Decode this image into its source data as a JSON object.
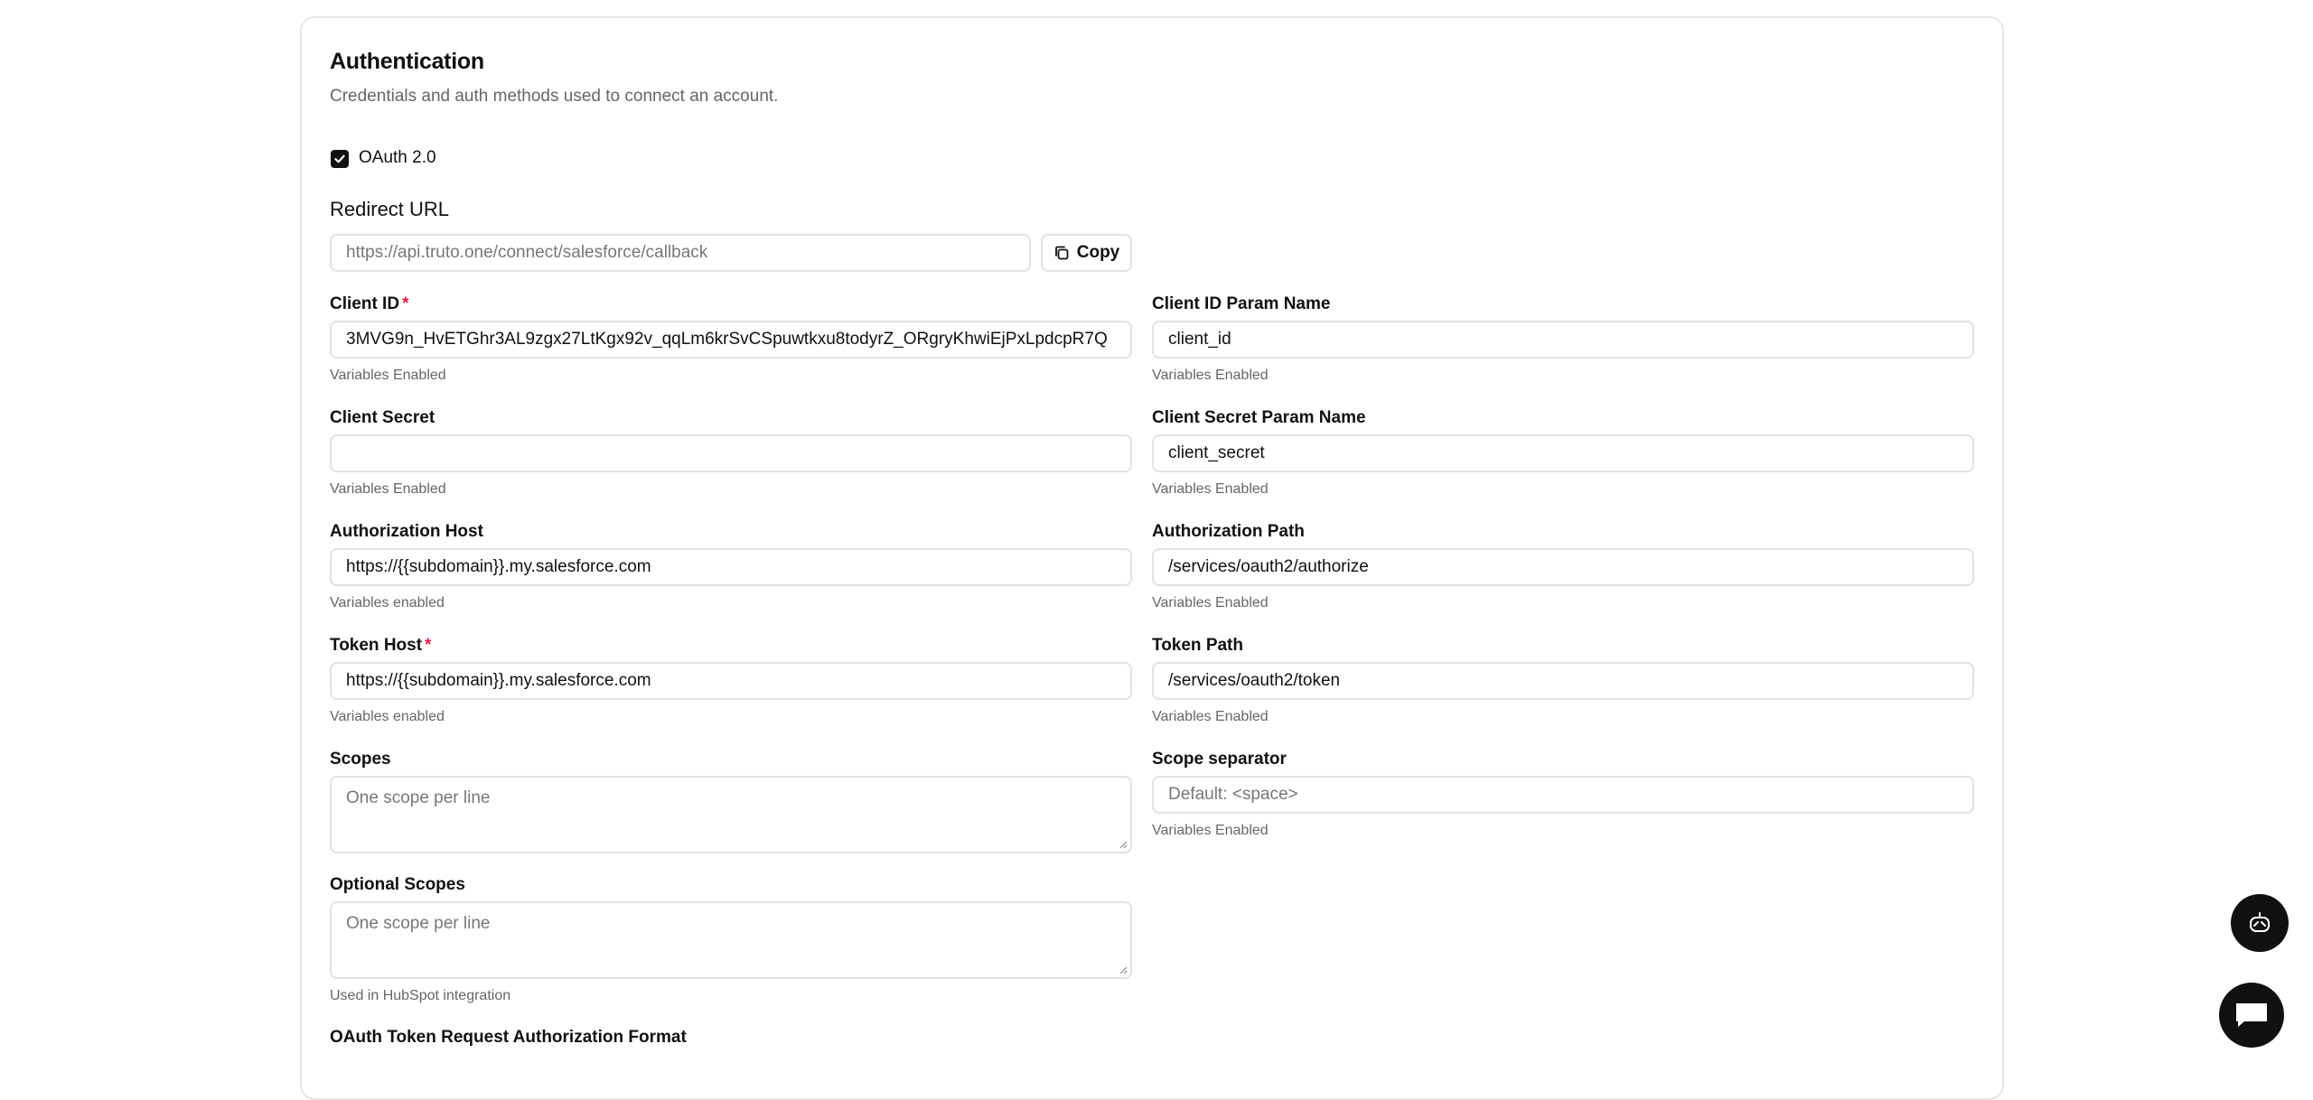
{
  "section": {
    "title": "Authentication",
    "subtitle": "Credentials and auth methods used to connect an account."
  },
  "oauth": {
    "checkbox_label": "OAuth 2.0",
    "checked": true
  },
  "redirect": {
    "label": "Redirect URL",
    "placeholder": "https://api.truto.one/connect/salesforce/callback",
    "copy_label": "Copy"
  },
  "fields": {
    "client_id": {
      "label": "Client ID",
      "required_mark": "*",
      "value": "3MVG9n_HvETGhr3AL9zgx27LtKgx92v_qqLm6krSvCSpuwtkxu8todyrZ_ORgryKhwiEjPxLpdcpR7Q",
      "help": "Variables Enabled"
    },
    "client_id_param": {
      "label": "Client ID Param Name",
      "value": "client_id",
      "help": "Variables Enabled"
    },
    "client_secret": {
      "label": "Client Secret",
      "value": "",
      "help": "Variables Enabled"
    },
    "client_secret_param": {
      "label": "Client Secret Param Name",
      "value": "client_secret",
      "help": "Variables Enabled"
    },
    "authorization_host": {
      "label": "Authorization Host",
      "value": "https://{{subdomain}}.my.salesforce.com",
      "help": "Variables enabled"
    },
    "authorization_path": {
      "label": "Authorization Path",
      "value": "/services/oauth2/authorize",
      "help": "Variables Enabled"
    },
    "token_host": {
      "label": "Token Host",
      "required_mark": "*",
      "value": "https://{{subdomain}}.my.salesforce.com",
      "help": "Variables enabled"
    },
    "token_path": {
      "label": "Token Path",
      "value": "/services/oauth2/token",
      "help": "Variables Enabled"
    },
    "scopes": {
      "label": "Scopes",
      "placeholder": "One scope per line"
    },
    "scope_separator": {
      "label": "Scope separator",
      "placeholder": "Default: <space>",
      "help": "Variables Enabled"
    },
    "optional_scopes": {
      "label": "Optional Scopes",
      "placeholder": "One scope per line",
      "help": "Used in HubSpot integration"
    },
    "token_request_format": {
      "label": "OAuth Token Request Authorization Format"
    }
  },
  "fabs": {
    "bot_icon": "bot-icon",
    "chat_icon": "chat-icon"
  },
  "colors": {
    "accent": "#111111",
    "required": "#e11d48",
    "border": "#e2e2e2"
  }
}
